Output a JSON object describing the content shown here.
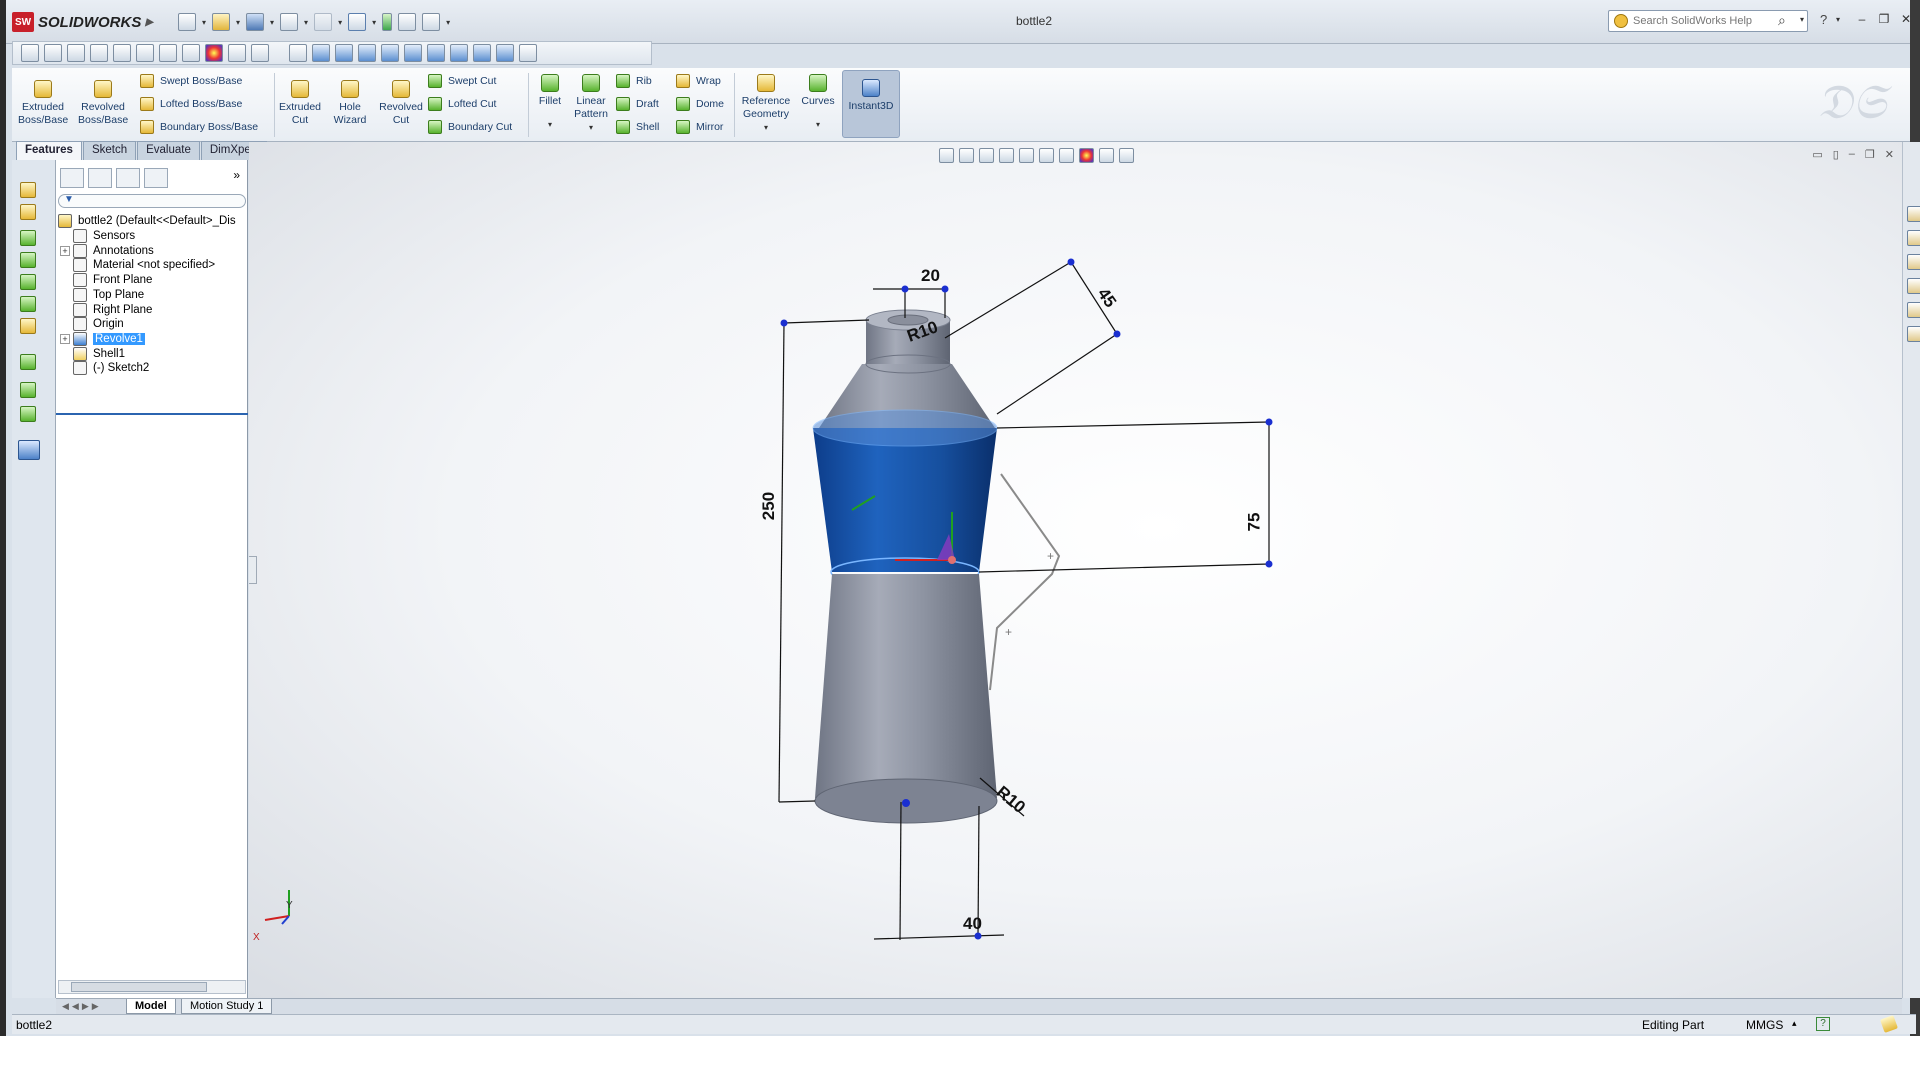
{
  "app": {
    "brand": "SOLIDWORKS",
    "document_title": "bottle2",
    "search_placeholder": "Search SolidWorks Help",
    "help_symbol": "?"
  },
  "ribbon": {
    "large_buttons": [
      {
        "label": "Extruded Boss/Base",
        "icon": "extruded-boss-icon"
      },
      {
        "label": "Revolved Boss/Base",
        "icon": "revolved-boss-icon"
      },
      {
        "label": "Extruded Cut",
        "icon": "extruded-cut-icon"
      },
      {
        "label": "Hole Wizard",
        "icon": "hole-wizard-icon"
      },
      {
        "label": "Revolved Cut",
        "icon": "revolved-cut-icon"
      },
      {
        "label": "Fillet",
        "icon": "fillet-icon"
      },
      {
        "label": "Linear Pattern",
        "icon": "linear-pattern-icon"
      },
      {
        "label": "Reference Geometry",
        "icon": "reference-geometry-icon"
      },
      {
        "label": "Curves",
        "icon": "curves-icon"
      },
      {
        "label": "Instant3D",
        "icon": "instant3d-icon"
      }
    ],
    "boss_group": [
      "Swept Boss/Base",
      "Lofted Boss/Base",
      "Boundary Boss/Base"
    ],
    "cut_group": [
      "Swept Cut",
      "Lofted Cut",
      "Boundary Cut"
    ],
    "feature_group_a": [
      "Rib",
      "Draft",
      "Shell"
    ],
    "feature_group_b": [
      "Wrap",
      "Dome",
      "Mirror"
    ]
  },
  "command_tabs": [
    "Features",
    "Sketch",
    "Evaluate",
    "DimXpert"
  ],
  "tree": {
    "root": "bottle2  (Default<<Default>_Dis",
    "items": [
      {
        "label": "Sensors",
        "expandable": false
      },
      {
        "label": "Annotations",
        "expandable": true
      },
      {
        "label": "Material <not specified>",
        "expandable": false
      },
      {
        "label": "Front Plane",
        "expandable": false
      },
      {
        "label": "Top Plane",
        "expandable": false
      },
      {
        "label": "Right Plane",
        "expandable": false
      },
      {
        "label": "Origin",
        "expandable": false
      },
      {
        "label": "Revolve1",
        "expandable": true,
        "selected": true
      },
      {
        "label": "Shell1",
        "expandable": false
      },
      {
        "label": "(-) Sketch2",
        "expandable": false
      }
    ]
  },
  "dimensions": {
    "top_width": "20",
    "top_radius": "R10",
    "angle": "45",
    "height": "250",
    "band": "75",
    "bottom_radius": "R10",
    "bottom_width": "40"
  },
  "triad": {
    "x_label": "X",
    "y_label": "Y"
  },
  "bottom_tabs": [
    "Model",
    "Motion Study 1"
  ],
  "status": {
    "left": "bottle2",
    "mode": "Editing Part",
    "units": "MMGS"
  },
  "colors": {
    "selection": "#3399ff",
    "face_highlight": "#1a5fb4",
    "body": "#8e94a3"
  }
}
